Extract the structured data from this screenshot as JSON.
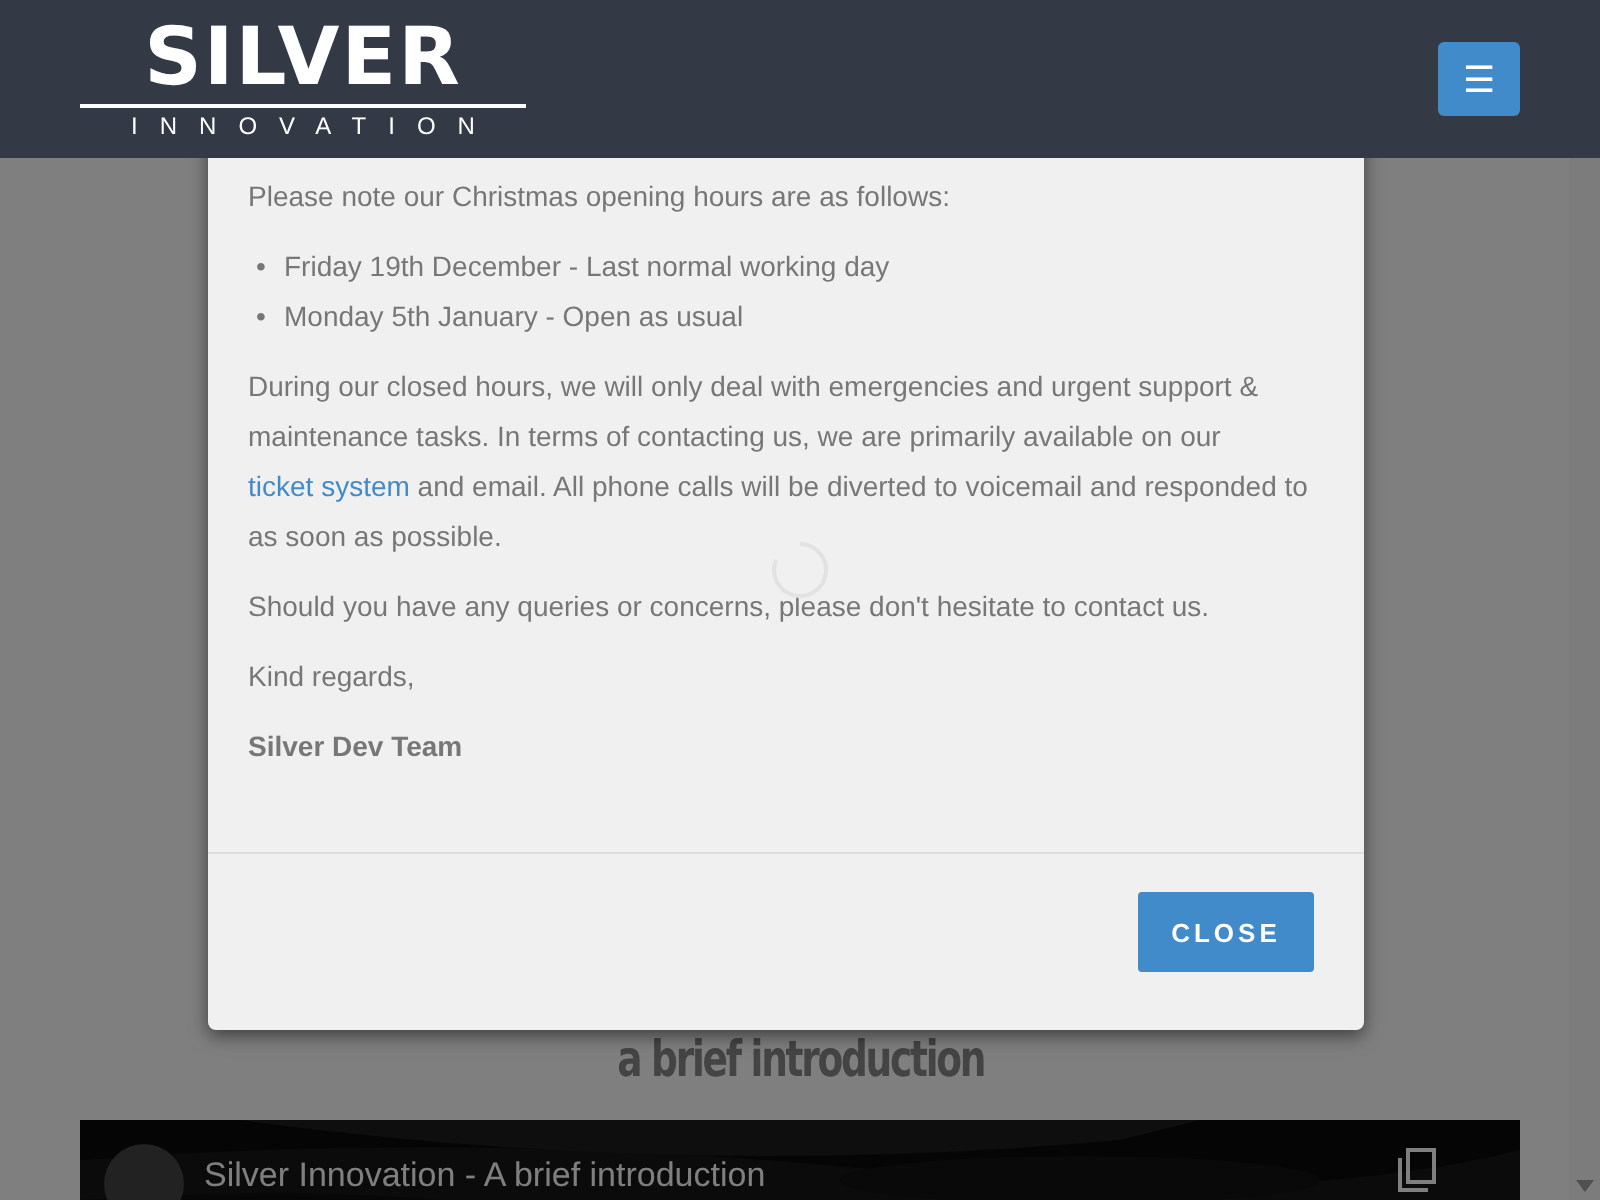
{
  "header": {
    "logo": {
      "word": "SILVER",
      "tagline": "INNOVATION"
    },
    "menu_button": "☰"
  },
  "modal": {
    "intro": "Please note our Christmas opening hours are as follows:",
    "list": [
      {
        "bullet": "•",
        "text": "Friday 19th December - Last normal working day"
      },
      {
        "bullet": "•",
        "text": "Monday 5th January - Open as usual"
      }
    ],
    "body_before_link": "During our closed hours, we will only deal with emergencies and urgent support & maintenance tasks. In terms of contacting us, we are primarily available on our",
    "link": "ticket system",
    "body_after_link": "and email. All phone calls will be diverted to voicemail and responded to as soon as possible.",
    "queries": "Should you have any queries or concerns, please don't hesitate to contact us.",
    "closing": "Kind regards,",
    "signature": "Silver Dev Team",
    "close_button": "CLOSE"
  },
  "page": {
    "heading": "a brief introduction",
    "video": {
      "kind": "picture",
      "title": "Silver Innovation - A brief introduction"
    }
  }
}
